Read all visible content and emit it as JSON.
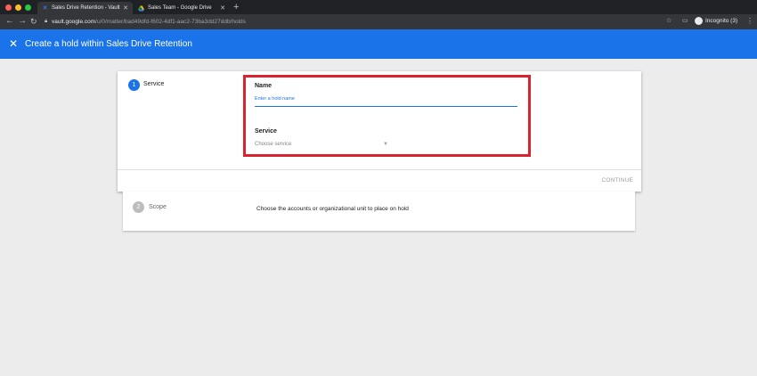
{
  "browser": {
    "tabs": [
      {
        "title": "Sales Drive Retention - Vault",
        "icon": "vault-icon",
        "active": true
      },
      {
        "title": "Sales Team - Google Drive",
        "icon": "drive-icon",
        "active": false
      }
    ],
    "url_host": "vault.google.com",
    "url_path": "/u/0/matter/bad49dfd-f602-4df1-aac2-73ba3dd27ddb/holds",
    "incognito_label": "Incognito (3)"
  },
  "appbar": {
    "title": "Create a hold within Sales Drive Retention",
    "color": "#1a73e8"
  },
  "steps": [
    {
      "number": "1",
      "label": "Service",
      "color": "#1a73e8"
    },
    {
      "number": "2",
      "label": "Scope",
      "color": "#bdbdbd",
      "description": "Choose the accounts or organizational unit to place on hold"
    }
  ],
  "form": {
    "name_label": "Name",
    "name_placeholder": "Enter a hold name",
    "name_value": "",
    "service_label": "Service",
    "service_placeholder": "Choose service",
    "highlight_color": "#d9232e"
  },
  "actions": {
    "continue_label": "CONTINUE"
  }
}
